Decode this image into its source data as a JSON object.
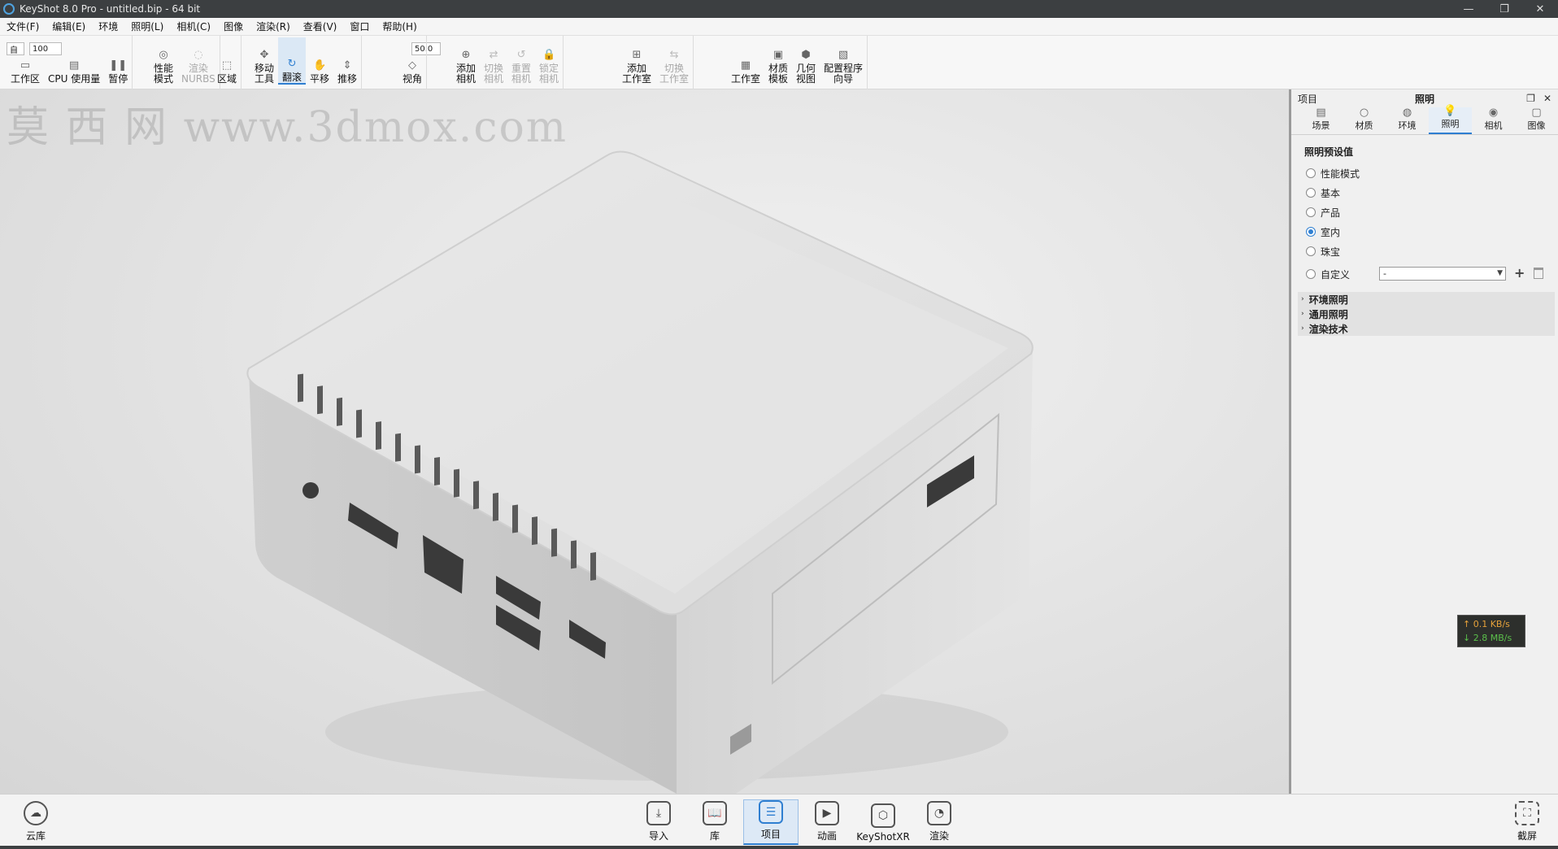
{
  "window": {
    "title": "KeyShot 8.0 Pro - untitled.bip - 64 bit",
    "controls": {
      "minimize": "—",
      "restore": "❐",
      "close": "✕"
    }
  },
  "watermark": "莫 西 网 www.3dmox.com",
  "menu": [
    "文件(F)",
    "编辑(E)",
    "环境",
    "照明(L)",
    "相机(C)",
    "图像",
    "渲染(R)",
    "查看(V)",
    "窗口",
    "帮助(H)"
  ],
  "toolbar": {
    "fields": {
      "workspace": "自",
      "cpu_usage": "100",
      "fov": "50.0"
    },
    "tools": [
      {
        "id": "workspace",
        "label": "工作区",
        "icon": "▭",
        "state": "normal"
      },
      {
        "id": "cpu",
        "label": "CPU 使用量",
        "icon": "▤",
        "state": "normal"
      },
      {
        "id": "pause",
        "label": "暂停",
        "icon": "❚❚",
        "state": "normal"
      },
      {
        "id": "performance",
        "label": "性能\n模式",
        "icon": "◎",
        "state": "normal"
      },
      {
        "id": "render-nurbs",
        "label": "渲染\nNURBS",
        "icon": "◌",
        "state": "disabled"
      },
      {
        "id": "region",
        "label": "区域",
        "icon": "⬚",
        "state": "normal"
      },
      {
        "id": "move-tool",
        "label": "移动\n工具",
        "icon": "✥",
        "state": "normal"
      },
      {
        "id": "tumble",
        "label": "翻滚",
        "icon": "↻",
        "state": "active"
      },
      {
        "id": "pan",
        "label": "平移",
        "icon": "✋",
        "state": "normal"
      },
      {
        "id": "dolly",
        "label": "推移",
        "icon": "⇕",
        "state": "normal"
      },
      {
        "id": "view-angle",
        "label": "视角",
        "icon": "◇",
        "state": "normal"
      },
      {
        "id": "add-camera",
        "label": "添加\n相机",
        "icon": "⊕",
        "state": "normal"
      },
      {
        "id": "switch-camera",
        "label": "切换\n相机",
        "icon": "⇄",
        "state": "disabled"
      },
      {
        "id": "reset-camera",
        "label": "重置\n相机",
        "icon": "↺",
        "state": "disabled"
      },
      {
        "id": "lock-camera",
        "label": "锁定\n相机",
        "icon": "🔒",
        "state": "disabled"
      },
      {
        "id": "add-studio",
        "label": "添加\n工作室",
        "icon": "⊞",
        "state": "normal"
      },
      {
        "id": "switch-studio",
        "label": "切换\n工作室",
        "icon": "⇆",
        "state": "disabled"
      },
      {
        "id": "studio",
        "label": "工作室",
        "icon": "▦",
        "state": "normal"
      },
      {
        "id": "material-template",
        "label": "材质\n模板",
        "icon": "▣",
        "state": "normal"
      },
      {
        "id": "geometry-view",
        "label": "几何\n视图",
        "icon": "⬢",
        "state": "normal"
      },
      {
        "id": "config-wizard",
        "label": "配置程序\n向导",
        "icon": "▧",
        "state": "normal"
      }
    ]
  },
  "panel": {
    "left_label": "项目",
    "title": "照明",
    "tabs": [
      {
        "label": "场景",
        "icon": "▤"
      },
      {
        "label": "材质",
        "icon": "○"
      },
      {
        "label": "环境",
        "icon": "◍"
      },
      {
        "label": "照明",
        "icon": "💡"
      },
      {
        "label": "相机",
        "icon": "◉"
      },
      {
        "label": "图像",
        "icon": "▢"
      }
    ],
    "active_tab": "照明",
    "presets_title": "照明预设值",
    "presets": [
      {
        "label": "性能模式",
        "checked": false
      },
      {
        "label": "基本",
        "checked": false
      },
      {
        "label": "产品",
        "checked": false
      },
      {
        "label": "室内",
        "checked": true
      },
      {
        "label": "珠宝",
        "checked": false
      },
      {
        "label": "自定义",
        "checked": false
      }
    ],
    "custom_select_value": "-",
    "sections": [
      "环境照明",
      "通用照明",
      "渲染技术"
    ]
  },
  "netmeter": {
    "up": "↑ 0.1 KB/s",
    "down": "↓ 2.8 MB/s"
  },
  "bottombar": {
    "cloud": {
      "label": "云库",
      "icon": "☁"
    },
    "buttons": [
      {
        "label": "导入",
        "icon": "⤓"
      },
      {
        "label": "库",
        "icon": "📖"
      },
      {
        "label": "项目",
        "icon": "☰"
      },
      {
        "label": "动画",
        "icon": "▶"
      },
      {
        "label": "KeyShotXR",
        "icon": "⬡"
      },
      {
        "label": "渲染",
        "icon": "◔"
      }
    ],
    "active": "项目",
    "screenshot": {
      "label": "截屏",
      "icon": "⛶"
    }
  }
}
